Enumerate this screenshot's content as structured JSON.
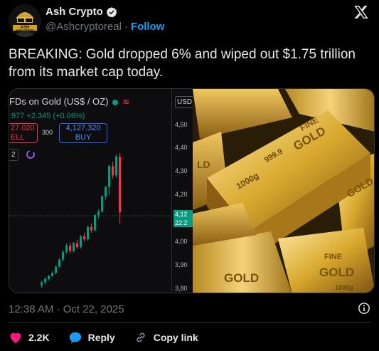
{
  "author": {
    "display_name": "Ash Crypto",
    "handle": "@Ashcryptoreal",
    "separator": "·",
    "follow_label": "Follow",
    "avatar_text": "ASH CRYPTO"
  },
  "tweet": {
    "text": "BREAKING: Gold dropped 6% and wiped out $1.75 trillion from its market cap today.",
    "timestamp": "12:38 AM · Oct 22, 2025"
  },
  "media": {
    "chart": {
      "title": "FDs on Gold (US$ / OZ)",
      "price_change": ".977 +2.345 (+0.06%)",
      "sell_price": "27.020",
      "sell_label": "ELL",
      "spread": "300",
      "buy_price": "4,127.320",
      "buy_label": "BUY",
      "interval_label": "2",
      "currency_label": "USD",
      "last_price": "4,12",
      "last_time": "22:2"
    },
    "photo": {
      "bar_text_1": "FINE",
      "bar_text_2": "GOLD",
      "bar_text_3": "999.9",
      "bar_text_4": "1000g",
      "bar_text_5": "LD",
      "bar_text_6": "GOLD",
      "bar_text_7": "FINE",
      "bar_text_8": "GOLD",
      "bar_text_9": "GOLD",
      "bar_text_10": "1000g"
    }
  },
  "actions": {
    "like_count": "2.2K",
    "reply_label": "Reply",
    "copy_label": "Copy link"
  },
  "chart_data": {
    "type": "candlestick",
    "y_ticks": [
      "4,50",
      "4,40",
      "4,30",
      "4,20",
      "4,00",
      "3,90",
      "3,80"
    ],
    "candles": [
      {
        "o": 3815,
        "h": 3835,
        "l": 3805,
        "c": 3828,
        "dir": "up"
      },
      {
        "o": 3828,
        "h": 3850,
        "l": 3820,
        "c": 3842,
        "dir": "up"
      },
      {
        "o": 3842,
        "h": 3860,
        "l": 3835,
        "c": 3855,
        "dir": "up"
      },
      {
        "o": 3855,
        "h": 3875,
        "l": 3850,
        "c": 3868,
        "dir": "up"
      },
      {
        "o": 3868,
        "h": 3900,
        "l": 3862,
        "c": 3895,
        "dir": "up"
      },
      {
        "o": 3895,
        "h": 3930,
        "l": 3890,
        "c": 3925,
        "dir": "up"
      },
      {
        "o": 3925,
        "h": 3965,
        "l": 3918,
        "c": 3958,
        "dir": "up"
      },
      {
        "o": 3958,
        "h": 3995,
        "l": 3950,
        "c": 3985,
        "dir": "up"
      },
      {
        "o": 3985,
        "h": 3998,
        "l": 3950,
        "c": 3962,
        "dir": "down"
      },
      {
        "o": 3962,
        "h": 4000,
        "l": 3955,
        "c": 3995,
        "dir": "up"
      },
      {
        "o": 3995,
        "h": 4010,
        "l": 3970,
        "c": 3978,
        "dir": "down"
      },
      {
        "o": 3978,
        "h": 4030,
        "l": 3972,
        "c": 4025,
        "dir": "up"
      },
      {
        "o": 4025,
        "h": 4040,
        "l": 4000,
        "c": 4012,
        "dir": "down"
      },
      {
        "o": 4012,
        "h": 4070,
        "l": 4005,
        "c": 4065,
        "dir": "up"
      },
      {
        "o": 4065,
        "h": 4080,
        "l": 4040,
        "c": 4050,
        "dir": "down"
      },
      {
        "o": 4050,
        "h": 4120,
        "l": 4045,
        "c": 4115,
        "dir": "up"
      },
      {
        "o": 4115,
        "h": 4140,
        "l": 4100,
        "c": 4130,
        "dir": "up"
      },
      {
        "o": 4130,
        "h": 4200,
        "l": 4125,
        "c": 4195,
        "dir": "up"
      },
      {
        "o": 4195,
        "h": 4240,
        "l": 4180,
        "c": 4235,
        "dir": "up"
      },
      {
        "o": 4235,
        "h": 4330,
        "l": 4200,
        "c": 4325,
        "dir": "up"
      },
      {
        "o": 4325,
        "h": 4345,
        "l": 4270,
        "c": 4285,
        "dir": "down"
      },
      {
        "o": 4285,
        "h": 4375,
        "l": 4275,
        "c": 4365,
        "dir": "up"
      },
      {
        "o": 4365,
        "h": 4380,
        "l": 4080,
        "c": 4127,
        "dir": "down"
      }
    ],
    "y_range": [
      3790,
      4520
    ]
  }
}
